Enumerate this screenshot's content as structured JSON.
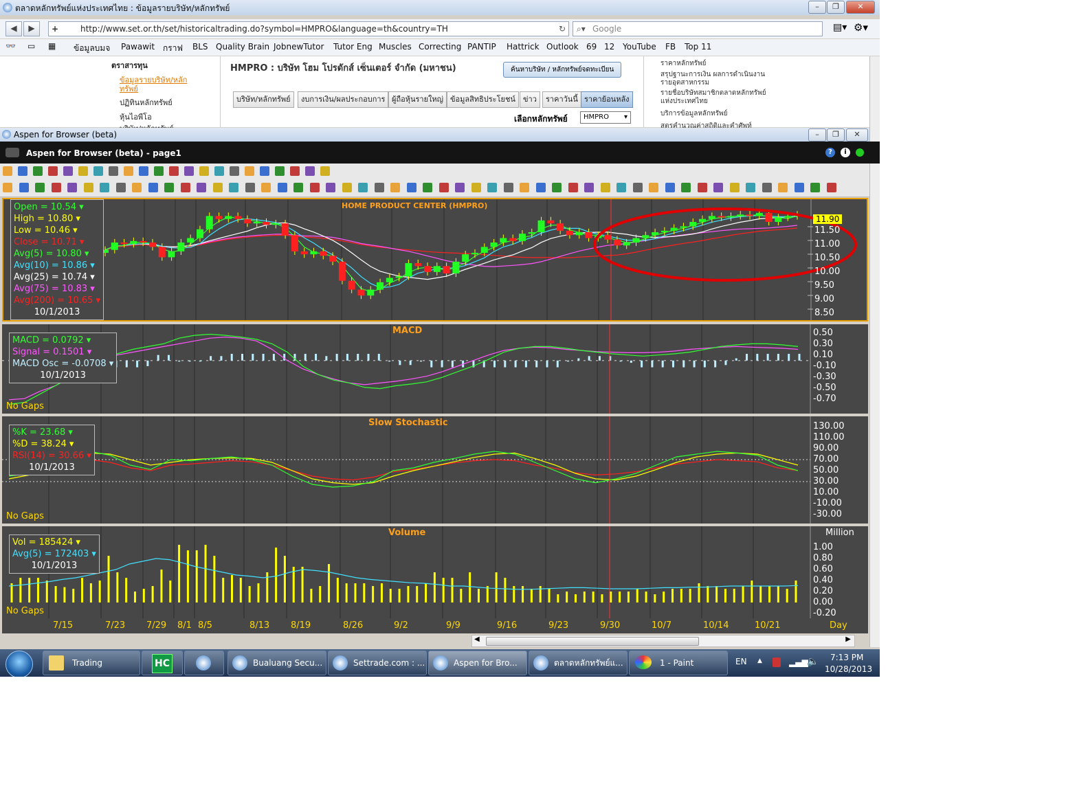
{
  "browser": {
    "title": "ตลาดหลักทรัพย์แห่งประเทศไทย : ข้อมูลรายบริษัท/หลักทรัพย์",
    "url": "http://www.set.or.th/set/historicaltrading.do?symbol=HMPRO&language=th&country=TH",
    "search_placeholder": "Google",
    "bookmarks": [
      "ข้อมูลบมจ",
      "Pawawit",
      "กราฟ",
      "BLS",
      "Quality Brain",
      "JobnewTutor",
      "Tutor Eng",
      "Muscles",
      "Correcting",
      "PANTIP",
      "Hattrick",
      "Outlook",
      "69",
      "12",
      "YouTube",
      "FB",
      "Top 11"
    ]
  },
  "website": {
    "left_heading": "ตราสารทุน",
    "left_links": [
      "ข้อมูลรายบริษัท/หลักทรัพย์",
      "ปฏิทินหลักทรัพย์",
      "หุ้นไอพีโอ",
      "บริษัท/หลักทรัพย์"
    ],
    "company_title": "HMPRO : บริษัท โฮม โปรดักส์ เซ็นเตอร์ จำกัด (มหาชน)",
    "search_company_button": "ค้นหาบริษัท / หลักทรัพย์จดทะเบียน",
    "tabs": [
      "บริษัท/หลักทรัพย์",
      "งบการเงิน/ผลประกอบการ",
      "ผู้ถือหุ้นรายใหญ่",
      "ข้อมูลสิทธิประโยชน์",
      "ข่าว",
      "ราคาวันนี้",
      "ราคาย้อนหลัง"
    ],
    "select_label": "เลือกหลักทรัพย์",
    "select_value": "HMPRO",
    "right_links": [
      "ราคาหลักทรัพย์",
      "สรุปฐานะการเงิน ผลการดำเนินงานรายอุตสาหกรรม",
      "รายชื่อบริษัทสมาชิกตลาดหลักทรัพย์แห่งประเทศไทย",
      "บริการข้อมูลหลักทรัพย์",
      "สูตรคำนวณค่าสถิติและคำศัพท์"
    ]
  },
  "aspen": {
    "outer_title": "Aspen for Browser (beta)",
    "inner_title": "Aspen for Browser (beta) - page1"
  },
  "price_panel": {
    "title": "HOME PRODUCT CENTER (HMPRO)",
    "legend": [
      {
        "label": "Open = 10.54",
        "color": "#32ff32"
      },
      {
        "label": "High = 10.80",
        "color": "#ffff00"
      },
      {
        "label": "Low = 10.46",
        "color": "#ffff00"
      },
      {
        "label": "Close = 10.71",
        "color": "#ff2020"
      },
      {
        "label": "Avg(5) = 10.80",
        "color": "#32ff32"
      },
      {
        "label": "Avg(10) = 10.86",
        "color": "#40e0ff"
      },
      {
        "label": "Avg(25) = 10.74",
        "color": "#ffffff"
      },
      {
        "label": "Avg(75) = 10.83",
        "color": "#ff55ff"
      },
      {
        "label": "Avg(200) = 10.65",
        "color": "#ff2020"
      }
    ],
    "date": "10/1/2013",
    "last_price": "11.90",
    "yticks": [
      "11.50",
      "11.00",
      "10.50",
      "10.00",
      "9.50",
      "9.00",
      "8.50"
    ]
  },
  "macd_panel": {
    "title": "MACD",
    "legend": [
      {
        "label": "MACD = 0.0792",
        "color": "#32ff32"
      },
      {
        "label": "Signal = 0.1501",
        "color": "#ff55ff"
      },
      {
        "label": "MACD Osc = -0.0708",
        "color": "#bfefff"
      }
    ],
    "date": "10/1/2013",
    "no_gaps": "No Gaps",
    "yticks": [
      "0.50",
      "0.30",
      "0.10",
      "-0.10",
      "-0.30",
      "-0.50",
      "-0.70"
    ]
  },
  "stoch_panel": {
    "title": "Slow Stochastic",
    "legend": [
      {
        "label": "%K = 23.68",
        "color": "#32ff32"
      },
      {
        "label": "%D = 38.24",
        "color": "#ffff00"
      },
      {
        "label": "RSI(14) = 30.66",
        "color": "#ff2020"
      }
    ],
    "date": "10/1/2013",
    "no_gaps": "No Gaps",
    "yticks": [
      "130.00",
      "110.00",
      "90.00",
      "70.00",
      "50.00",
      "30.00",
      "10.00",
      "-10.00",
      "-30.00"
    ]
  },
  "volume_panel": {
    "title": "Volume",
    "legend": [
      {
        "label": "Vol = 185424",
        "color": "#ffff00"
      },
      {
        "label": "Avg(5) = 172403",
        "color": "#40e0ff"
      }
    ],
    "date": "10/1/2013",
    "no_gaps": "No Gaps",
    "unit": "Million",
    "yticks": [
      "1.00",
      "0.80",
      "0.60",
      "0.40",
      "0.20",
      "0.00",
      "-0.20"
    ]
  },
  "xaxis": {
    "labels": [
      "7/15",
      "7/23",
      "7/29",
      "8/1",
      "8/5",
      "8/13",
      "8/19",
      "8/26",
      "9/2",
      "9/9",
      "9/16",
      "9/23",
      "9/30",
      "10/7",
      "10/14",
      "10/21"
    ],
    "unit": "Day"
  },
  "chart_data": [
    {
      "type": "candlestick",
      "title": "HOME PRODUCT CENTER (HMPRO)",
      "ylim": [
        8.5,
        12.0
      ],
      "close": [
        10.7,
        10.95,
        10.9,
        11.0,
        10.95,
        10.8,
        10.45,
        10.65,
        10.95,
        11.1,
        11.4,
        11.85,
        11.75,
        11.85,
        11.75,
        11.6,
        11.65,
        11.55,
        11.6,
        11.2,
        10.65,
        10.55,
        10.65,
        10.5,
        10.3,
        9.65,
        9.35,
        9.15,
        9.35,
        9.6,
        9.75,
        9.8,
        10.25,
        10.15,
        9.95,
        10.15,
        9.9,
        10.3,
        10.55,
        10.6,
        10.8,
        10.95,
        11.1,
        11.0,
        11.25,
        11.3,
        11.7,
        11.6,
        11.35,
        11.2,
        11.3,
        11.1,
        11.2,
        11.05,
        10.85,
        10.95,
        11.1,
        11.2,
        11.3,
        11.35,
        11.45,
        11.5,
        11.65,
        11.75,
        11.85,
        11.8,
        11.85,
        11.9,
        11.85,
        11.95,
        11.65,
        11.8,
        11.85,
        11.9
      ],
      "avg5_last": 10.8,
      "avg10_last": 10.86,
      "avg25_last": 10.74,
      "avg75_last": 10.83,
      "avg200_last": 10.65
    },
    {
      "type": "line",
      "title": "MACD",
      "ylim": [
        -0.8,
        0.55
      ],
      "macd": [
        -0.78,
        -0.75,
        -0.6,
        -0.45,
        -0.3,
        -0.15,
        0.0,
        0.12,
        0.2,
        0.25,
        0.3,
        0.4,
        0.45,
        0.47,
        0.45,
        0.42,
        0.38,
        0.3,
        0.15,
        -0.1,
        -0.25,
        -0.35,
        -0.4,
        -0.48,
        -0.5,
        -0.45,
        -0.42,
        -0.38,
        -0.3,
        -0.2,
        -0.1,
        0.02,
        0.15,
        0.22,
        0.25,
        0.25,
        0.22,
        0.18,
        0.15,
        0.12,
        0.1,
        0.08,
        0.1,
        0.12,
        0.15,
        0.2,
        0.25,
        0.28,
        0.3,
        0.3,
        0.28,
        0.25
      ],
      "signal": [
        -0.7,
        -0.68,
        -0.55,
        -0.45,
        -0.3,
        -0.15,
        0.0,
        0.1,
        0.15,
        0.2,
        0.25,
        0.3,
        0.35,
        0.4,
        0.42,
        0.4,
        0.35,
        0.2,
        0.0,
        -0.15,
        -0.25,
        -0.33,
        -0.4,
        -0.43,
        -0.4,
        -0.37,
        -0.33,
        -0.28,
        -0.2,
        -0.1,
        0.0,
        0.1,
        0.18,
        0.22,
        0.24,
        0.23,
        0.2,
        0.18,
        0.16,
        0.15,
        0.14,
        0.14,
        0.15,
        0.17,
        0.2,
        0.22,
        0.24,
        0.25,
        0.24,
        0.23,
        0.22,
        0.2
      ]
    },
    {
      "type": "line",
      "title": "Slow Stochastic",
      "ylim": [
        -30,
        130
      ],
      "k": [
        40,
        45,
        60,
        80,
        85,
        78,
        60,
        52,
        70,
        68,
        72,
        75,
        70,
        60,
        40,
        25,
        20,
        22,
        30,
        50,
        55,
        65,
        72,
        80,
        85,
        80,
        65,
        50,
        35,
        28,
        35,
        45,
        60,
        75,
        80,
        85,
        82,
        78,
        60,
        50
      ],
      "d": [
        35,
        42,
        55,
        72,
        82,
        80,
        70,
        60,
        65,
        70,
        72,
        73,
        72,
        65,
        50,
        35,
        28,
        25,
        28,
        40,
        50,
        58,
        66,
        74,
        80,
        82,
        72,
        60,
        45,
        35,
        33,
        40,
        52,
        65,
        75,
        80,
        82,
        80,
        70,
        60
      ],
      "rsi": [
        55,
        58,
        68,
        72,
        70,
        65,
        55,
        50,
        60,
        62,
        65,
        68,
        66,
        60,
        50,
        40,
        35,
        33,
        38,
        48,
        52,
        58,
        64,
        68,
        70,
        68,
        60,
        54,
        46,
        42,
        44,
        48,
        55,
        62,
        66,
        70,
        68,
        66,
        55,
        50
      ]
    },
    {
      "type": "bar",
      "title": "Volume",
      "ylabel": "Million",
      "ylim": [
        -0.2,
        1.1
      ],
      "values": [
        0.35,
        0.45,
        0.45,
        0.45,
        0.4,
        0.3,
        0.28,
        0.25,
        0.45,
        0.35,
        0.4,
        0.85,
        0.55,
        0.45,
        0.2,
        0.25,
        0.3,
        0.6,
        0.4,
        1.05,
        0.95,
        0.95,
        1.05,
        0.85,
        0.45,
        0.5,
        0.45,
        0.3,
        0.35,
        0.55,
        1.0,
        0.85,
        0.65,
        0.65,
        0.25,
        0.3,
        0.7,
        0.45,
        0.35,
        0.35,
        0.35,
        0.3,
        0.35,
        0.25,
        0.25,
        0.3,
        0.3,
        0.35,
        0.55,
        0.45,
        0.45,
        0.25,
        0.55,
        0.25,
        0.3,
        0.55,
        0.45,
        0.3,
        0.3,
        0.25,
        0.3,
        0.25,
        0.15,
        0.2,
        0.15,
        0.2,
        0.2,
        0.15,
        0.2,
        0.2,
        0.2,
        0.25,
        0.2,
        0.15,
        0.2,
        0.25,
        0.25,
        0.25,
        0.35,
        0.3,
        0.3,
        0.25,
        0.25,
        0.3,
        0.4,
        0.3,
        0.3,
        0.3,
        0.25,
        0.4
      ],
      "avg5": [
        0.3,
        0.32,
        0.35,
        0.38,
        0.42,
        0.45,
        0.5,
        0.55,
        0.6,
        0.7,
        0.75,
        0.8,
        0.78,
        0.72,
        0.65,
        0.6,
        0.55,
        0.5,
        0.48,
        0.45,
        0.48,
        0.55,
        0.6,
        0.58,
        0.55,
        0.5,
        0.45,
        0.42,
        0.4,
        0.38,
        0.36,
        0.35,
        0.33,
        0.3,
        0.3,
        0.28,
        0.26,
        0.25,
        0.24,
        0.24,
        0.25,
        0.26,
        0.27,
        0.27,
        0.26,
        0.25,
        0.25,
        0.25,
        0.26,
        0.27,
        0.27,
        0.28,
        0.28,
        0.29,
        0.3,
        0.3,
        0.3,
        0.3,
        0.3,
        0.31
      ]
    }
  ],
  "taskbar": {
    "items": [
      "Trading",
      "HC",
      "",
      "Bualuang Secu...",
      "Settrade.com : ...",
      "Aspen for Bro...",
      "ตลาดหลักทรัพย์แ...",
      "1 - Paint"
    ],
    "lang": "EN",
    "time": "7:13 PM",
    "date": "10/28/2013"
  }
}
